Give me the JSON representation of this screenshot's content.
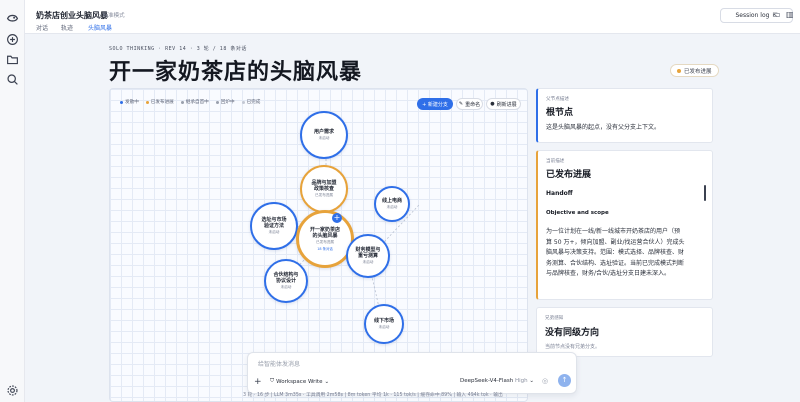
{
  "app": {
    "title": "奶茶店创业头脑风暴",
    "mode_label": "标准模式",
    "session_button": "Session log"
  },
  "tabs": [
    {
      "label": "对话"
    },
    {
      "label": "轨迹"
    },
    {
      "label": "头脑风暴",
      "active": true
    }
  ],
  "sidebar": {
    "icons": [
      "logo-icon",
      "new-chat-icon",
      "folder-icon",
      "search-icon",
      "settings-icon"
    ]
  },
  "header": {
    "kicker": "SOLO THINKING · REV 14 · 3 轮 / 18 条对话",
    "title": "开一家奶茶店的头脑风暴",
    "status": "已发布进展"
  },
  "legend": [
    {
      "label": "发散中",
      "color": "#2f6fe8"
    },
    {
      "label": "已发布进展",
      "color": "#e7a33b"
    },
    {
      "label": "继承自首中",
      "color": "#9aa0ad"
    },
    {
      "label": "回炉中",
      "color": "#9aa0ad"
    },
    {
      "label": "已完成",
      "color": "#c4c9d4"
    }
  ],
  "canvas_buttons": {
    "new_branch": "+ 新建分支",
    "rename": "重命名",
    "refresh": "刷新进展"
  },
  "nodes": [
    {
      "id": "user-needs",
      "label": "用户需求",
      "status": "未启动"
    },
    {
      "id": "brand",
      "label": "品牌与加盟\n政策核查",
      "status": "已发布进展"
    },
    {
      "id": "site",
      "label": "选址与市场\n验证方法",
      "status": "未启动"
    },
    {
      "id": "root",
      "label": "开一家奶茶店\n的头脑风暴",
      "status": "已发布进展",
      "sub": "18 条对话"
    },
    {
      "id": "online",
      "label": "线上电商",
      "status": "未启动"
    },
    {
      "id": "finance",
      "label": "财务模型与\n重亏测算",
      "status": "未启动"
    },
    {
      "id": "partner",
      "label": "合伙结构与\n协议设计",
      "status": "未启动"
    },
    {
      "id": "offline",
      "label": "线下市场",
      "status": "未启动"
    }
  ],
  "cards": {
    "node_desc": {
      "kicker": "父节点描述",
      "title": "根节点",
      "text": "这是头脑风暴的起点，没有父分支上下文。"
    },
    "current": {
      "kicker": "当前描述",
      "title": "已发布进展",
      "h1": "Handoff",
      "h2": "Objective and scope",
      "body": [
        "为一位计划在一线/新一线城市开奶茶店的用户（预",
        "算 50 万+，倾向加盟、副业/找运营合伙人）完成头",
        "脑风暴与决策支持。范围：模式选择、品牌核查、财",
        "务测算、合伙结构、选址验证。当前已完成模式判断",
        "与品牌核查，财务/合伙/选址分支日建未深入。"
      ]
    },
    "siblings": {
      "kicker": "兄弟感知",
      "title": "没有同级方向",
      "text": "当前节点没有兄弟分支。"
    }
  },
  "composer": {
    "placeholder": "给智能体发消息",
    "workspace": "Workspace Write",
    "model": "DeepSeek-V4-Flash",
    "model_level": "High"
  },
  "statusline": "3 轮 · 16 步  |  LLM 3m35s · 工具调用 2m58s  |  8m token 平均 1k · 115 tok/s  |  缓存命中 89%  |  输入 494k tok · 输出"
}
